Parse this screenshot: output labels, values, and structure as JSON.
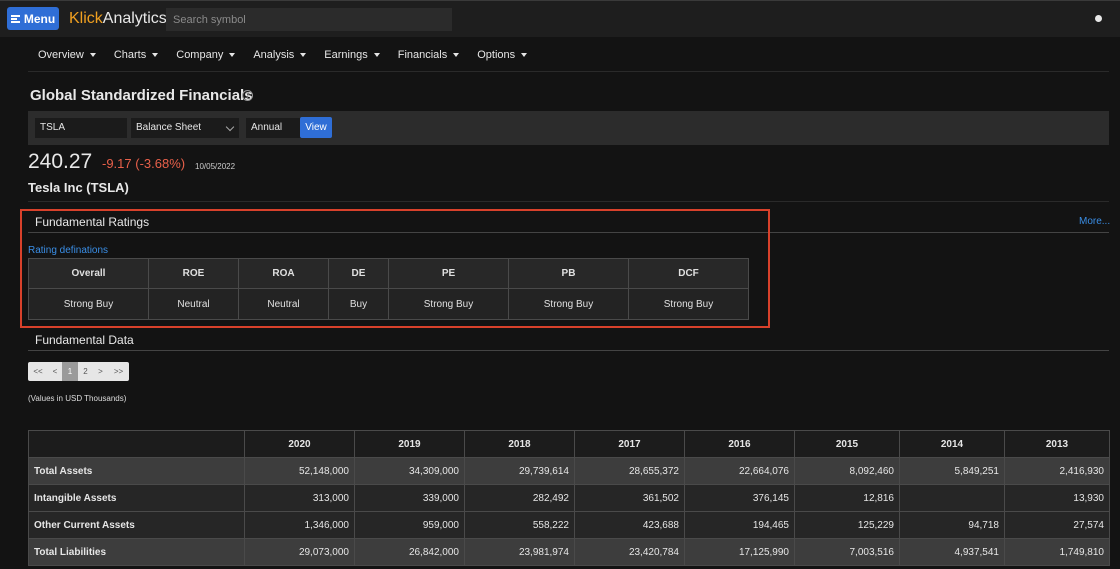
{
  "header": {
    "menu_label": "Menu",
    "brand_part1": "Klick",
    "brand_part2": "Analytics",
    "search_placeholder": "Search symbol"
  },
  "nav": [
    "Overview",
    "Charts",
    "Company",
    "Analysis",
    "Earnings",
    "Financials",
    "Options"
  ],
  "page": {
    "title": "Global Standardized Financials",
    "help_icon": "?"
  },
  "filters": {
    "symbol": "TSLA",
    "statement": "Balance Sheet",
    "period": "Annual",
    "view_label": "View"
  },
  "quote": {
    "price": "240.27",
    "change": "-9.17 (-3.68%)",
    "date": "10/05/2022",
    "company": "Tesla Inc (TSLA)"
  },
  "ratings": {
    "title": "Fundamental Ratings",
    "more_label": "More...",
    "definitions_link": "Rating definations",
    "headers": [
      "Overall",
      "ROE",
      "ROA",
      "DE",
      "PE",
      "PB",
      "DCF"
    ],
    "values": [
      "Strong Buy",
      "Neutral",
      "Neutral",
      "Buy",
      "Strong Buy",
      "Strong Buy",
      "Strong Buy"
    ]
  },
  "fundamental": {
    "title": "Fundamental Data",
    "pager": [
      "<<",
      "<",
      "1",
      "2",
      ">",
      ">>"
    ],
    "current_page": "1",
    "units_note": "(Values in USD Thousands)",
    "years": [
      "2020",
      "2019",
      "2018",
      "2017",
      "2016",
      "2015",
      "2014",
      "2013"
    ],
    "rows": [
      {
        "label": "Total Assets",
        "values": [
          "52,148,000",
          "34,309,000",
          "29,739,614",
          "28,655,372",
          "22,664,076",
          "8,092,460",
          "5,849,251",
          "2,416,930"
        ]
      },
      {
        "label": "Intangible Assets",
        "values": [
          "313,000",
          "339,000",
          "282,492",
          "361,502",
          "376,145",
          "12,816",
          "",
          "13,930"
        ]
      },
      {
        "label": "Other Current Assets",
        "values": [
          "1,346,000",
          "959,000",
          "558,222",
          "423,688",
          "194,465",
          "125,229",
          "94,718",
          "27,574"
        ]
      },
      {
        "label": "Total Liabilities",
        "values": [
          "29,073,000",
          "26,842,000",
          "23,981,974",
          "23,420,784",
          "17,125,990",
          "7,003,516",
          "4,937,541",
          "1,749,810"
        ]
      }
    ]
  },
  "colors": {
    "accent": "#2f6ed6",
    "negative": "#e8604a",
    "highlight": "#d8412b",
    "link": "#3a8ee6"
  }
}
